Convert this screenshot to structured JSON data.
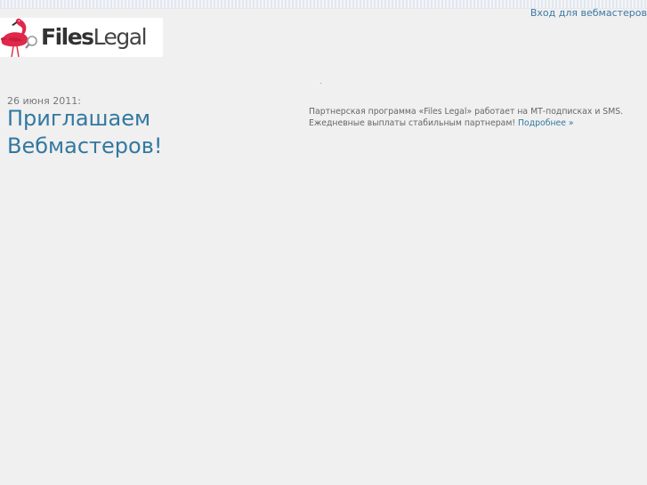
{
  "header": {
    "login_link": "Вход для вебмастеров"
  },
  "logo": {
    "text_bold": "Files",
    "text_light": "Legal",
    "icon": "flamingo-icon"
  },
  "news": {
    "date": "26 июня 2011:",
    "title": "Приглашаем Вебмастеров!"
  },
  "promo": {
    "line1": "Партнерская программа «Files Legal» работает на МТ-подписках и SMS.",
    "line2": "Ежедневные выплаты стабильным партнерам!",
    "more_link": "Подробнее »"
  },
  "colors": {
    "background": "#f0f0f0",
    "link": "#3378a0",
    "flamingo": "#e0284a"
  }
}
